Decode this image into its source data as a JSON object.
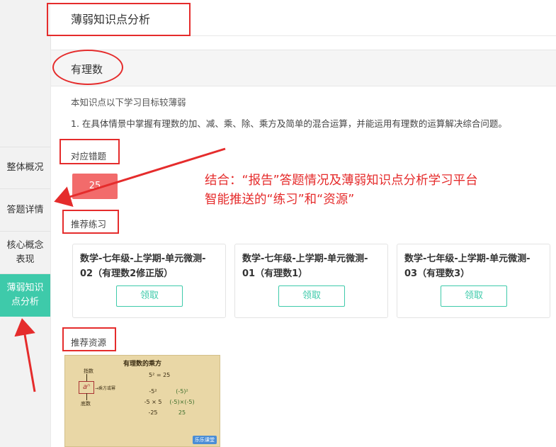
{
  "sidebar": {
    "items": [
      {
        "label": "整体概况"
      },
      {
        "label": "答题详情"
      },
      {
        "label_line1": "核心概念",
        "label_line2": "表现"
      },
      {
        "label_line1": "薄弱知识",
        "label_line2": "点分析"
      }
    ]
  },
  "page": {
    "title": "薄弱知识点分析"
  },
  "knowledge_point": {
    "name": "有理数",
    "intro": "本知识点以下学习目标较薄弱",
    "weak_goal": "1. 在具体情景中掌握有理数的加、减、乘、除、乘方及简单的混合运算，并能运用有理数的运算解决综合问题。"
  },
  "wrong_questions": {
    "label": "对应错题",
    "button_text": "25"
  },
  "exercises": {
    "label": "推荐练习",
    "items": [
      {
        "title_line1": "数学-七年级-上学期-单元微测-",
        "title_line2": "02（有理数2修正版）",
        "button": "领取"
      },
      {
        "title_line1": "数学-七年级-上学期-单元微测-",
        "title_line2": "01（有理数1）",
        "button": "领取"
      },
      {
        "title_line1": "数学-七年级-上学期-单元微测-",
        "title_line2": "03（有理数3）",
        "button": "领取"
      }
    ]
  },
  "resources": {
    "label": "推荐资源",
    "thumbnail": {
      "title": "有理数的乘方",
      "index_label": "指数",
      "base_label": "底数",
      "power_label": "→乘方或幂",
      "symbol": "aⁿ",
      "eq1": "5² = 25",
      "col1": [
        "-5²",
        "-5 × 5",
        "-25"
      ],
      "col2": [
        "(-5)²",
        "(-5)×(-5)",
        "25"
      ],
      "logo": "乐乐课堂"
    }
  },
  "annotation": {
    "line1": "结合：“报告”答题情况及薄弱知识点分析学习平台",
    "line2": "智能推送的“练习”和“资源”"
  },
  "colors": {
    "accent": "#3ecaaa",
    "danger": "#f26b6b",
    "annotation": "#e52c2c"
  }
}
